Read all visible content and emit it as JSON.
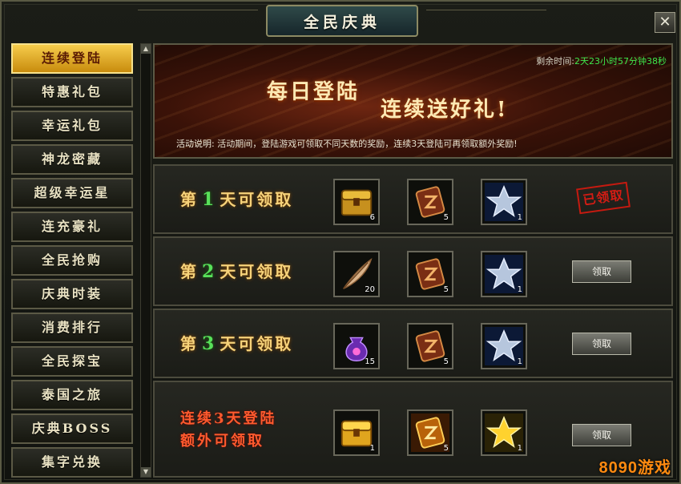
{
  "window": {
    "title": "全民庆典",
    "close_label": "✕"
  },
  "sidebar": {
    "items": [
      {
        "label": "连续登陆",
        "active": true
      },
      {
        "label": "特惠礼包"
      },
      {
        "label": "幸运礼包"
      },
      {
        "label": "神龙密藏"
      },
      {
        "label": "超级幸运星"
      },
      {
        "label": "连充豪礼"
      },
      {
        "label": "全民抢购"
      },
      {
        "label": "庆典时装"
      },
      {
        "label": "消费排行"
      },
      {
        "label": "全民探宝"
      },
      {
        "label": "泰国之旅"
      },
      {
        "label": "庆典BOSS"
      },
      {
        "label": "集字兑换"
      }
    ]
  },
  "banner": {
    "remain_label": "剩余时间:",
    "remain_value": "2天23小时57分钟38秒",
    "title_1": "每日登陆",
    "title_2": "连续送好礼!",
    "desc_label": "活动说明:",
    "desc_text": "活动期间，登陆游戏可领取不同天数的奖励，连续3天登陆可再领取额外奖励!"
  },
  "rows": [
    {
      "prefix": "第",
      "num": "1",
      "suffix": "天可领取",
      "items": [
        {
          "icon": "treasure-chest-icon",
          "qty": "6"
        },
        {
          "icon": "rune-scroll-icon",
          "qty": "5"
        },
        {
          "icon": "silver-star-icon",
          "qty": "1"
        }
      ],
      "status": "已领取"
    },
    {
      "prefix": "第",
      "num": "2",
      "suffix": "天可领取",
      "items": [
        {
          "icon": "feather-icon",
          "qty": "20"
        },
        {
          "icon": "rune-scroll-icon",
          "qty": "5"
        },
        {
          "icon": "silver-star-icon",
          "qty": "1"
        }
      ],
      "button": "领取"
    },
    {
      "prefix": "第",
      "num": "3",
      "suffix": "天可领取",
      "items": [
        {
          "icon": "purple-pouch-icon",
          "qty": "15"
        },
        {
          "icon": "rune-scroll-icon",
          "qty": "5"
        },
        {
          "icon": "silver-star-icon",
          "qty": "1"
        }
      ],
      "button": "领取"
    },
    {
      "line1": "连续3天登陆",
      "line2": "额外可领取",
      "items": [
        {
          "icon": "gold-chest-icon",
          "qty": "1"
        },
        {
          "icon": "gold-rune-icon",
          "qty": "5"
        },
        {
          "icon": "gold-star-icon",
          "qty": "1"
        }
      ],
      "button": "领取"
    }
  ],
  "watermark": "8090游戏",
  "colors": {
    "accent_gold": "#f6cd4c",
    "timer_green": "#3fe64b",
    "stamp_red": "#c51a10"
  }
}
